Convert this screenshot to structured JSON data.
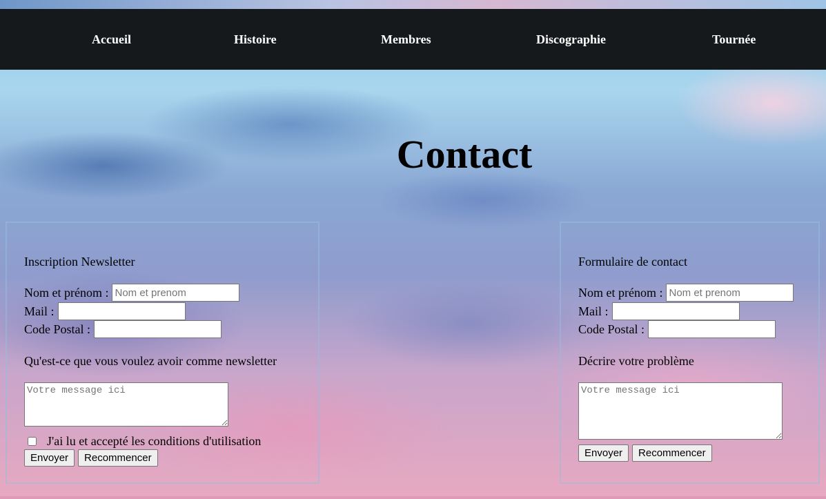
{
  "nav": {
    "items": [
      {
        "label": "Accueil"
      },
      {
        "label": "Histoire"
      },
      {
        "label": "Membres"
      },
      {
        "label": "Discographie"
      },
      {
        "label": "Tournée"
      }
    ]
  },
  "page": {
    "title": "Contact"
  },
  "newsletter": {
    "heading": "Inscription Newsletter",
    "name_label": "Nom et prénom :",
    "name_placeholder": "Nom et prenom",
    "mail_label": "Mail :",
    "postal_label": "Code Postal :",
    "question": "Qu'est-ce que vous voulez avoir comme newsletter",
    "message_placeholder": "Votre message ici",
    "terms_label": "J'ai lu et accepté les conditions d'utilisation",
    "terms_checked": false,
    "submit_label": "Envoyer",
    "reset_label": "Recommencer"
  },
  "contact": {
    "heading": "Formulaire de contact",
    "name_label": "Nom et prénom :",
    "name_placeholder": "Nom et prenom",
    "mail_label": "Mail :",
    "postal_label": "Code Postal :",
    "question": "Décrire votre problème",
    "message_placeholder": "Votre message ici",
    "submit_label": "Envoyer",
    "reset_label": "Recommencer"
  }
}
